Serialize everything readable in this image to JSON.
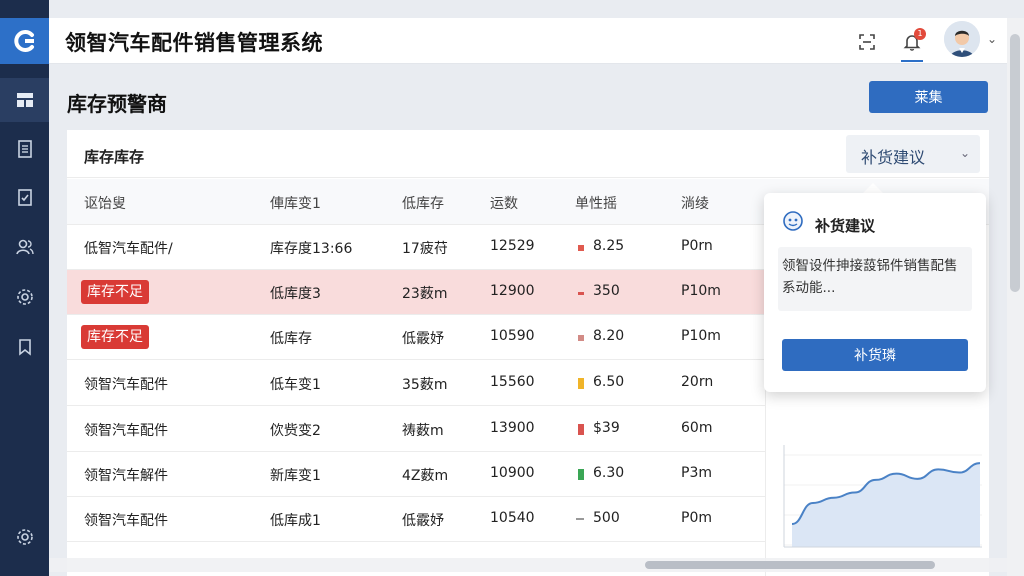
{
  "app": {
    "title": "领智汽车配件销售管理系统"
  },
  "header": {
    "bell_badge": "1"
  },
  "page": {
    "title": "库存预警商",
    "primary_button": "莱集"
  },
  "card": {
    "title": "库存库存",
    "select_value": "补货建议"
  },
  "table": {
    "columns": [
      "讴饴叟",
      "俥库变1",
      "低库存",
      "运数",
      "单性摇",
      "淌绫"
    ],
    "rows": [
      {
        "c0": "低智汽车配件/",
        "c1": "库存度13:66",
        "c2": "17疲苻",
        "c3": "12529",
        "c4": "8.25",
        "c5": "P0rn",
        "dot": "#e05a4f"
      },
      {
        "badge": "库存不足",
        "c1": "低库度3",
        "c2": "23薮m",
        "c3": "12900",
        "c4": "350",
        "c5": "P10m",
        "dot": "#d9534f"
      },
      {
        "badge": "库存不足",
        "c1": "低库存",
        "c2": "低霰妤",
        "c3": "10590",
        "c4": "8.20",
        "c5": "P10m",
        "dot": "#d28b86"
      },
      {
        "c0": "领智汽车配件",
        "c1": "低车变1",
        "c2": "35薮m",
        "c3": "15560",
        "c4": "6.50",
        "c5": "20rn",
        "dot": "#f0b429"
      },
      {
        "c0": "领智汽车配件",
        "c1": "佽赀变2",
        "c2": "祷薮m",
        "c3": "13900",
        "c4": "$39",
        "c5": "60m",
        "dot": "#d9534f"
      },
      {
        "c0": "领智汽车解件",
        "c1": "新库变1",
        "c2": "4Z薮m",
        "c3": "10900",
        "c4": "6.30",
        "c5": "P3m",
        "dot": "#3aa655"
      },
      {
        "c0": "领智汽车配件",
        "c1": "低库成1",
        "c2": "低霰妤",
        "c3": "10540",
        "c4": "500",
        "c5": "P0m",
        "dot": "#999999"
      }
    ]
  },
  "popover": {
    "title": "补货建议",
    "description": "领智设件抻接蔎铞件销售配售系动能...",
    "button": "补货璘"
  },
  "chart_data": {
    "type": "area",
    "title": "",
    "xlabel": "",
    "ylabel": "",
    "series": [
      {
        "values": [
          2,
          4,
          4.5,
          5,
          6.2,
          6.8,
          6.3,
          7.2,
          6.9,
          7.8
        ]
      }
    ]
  }
}
